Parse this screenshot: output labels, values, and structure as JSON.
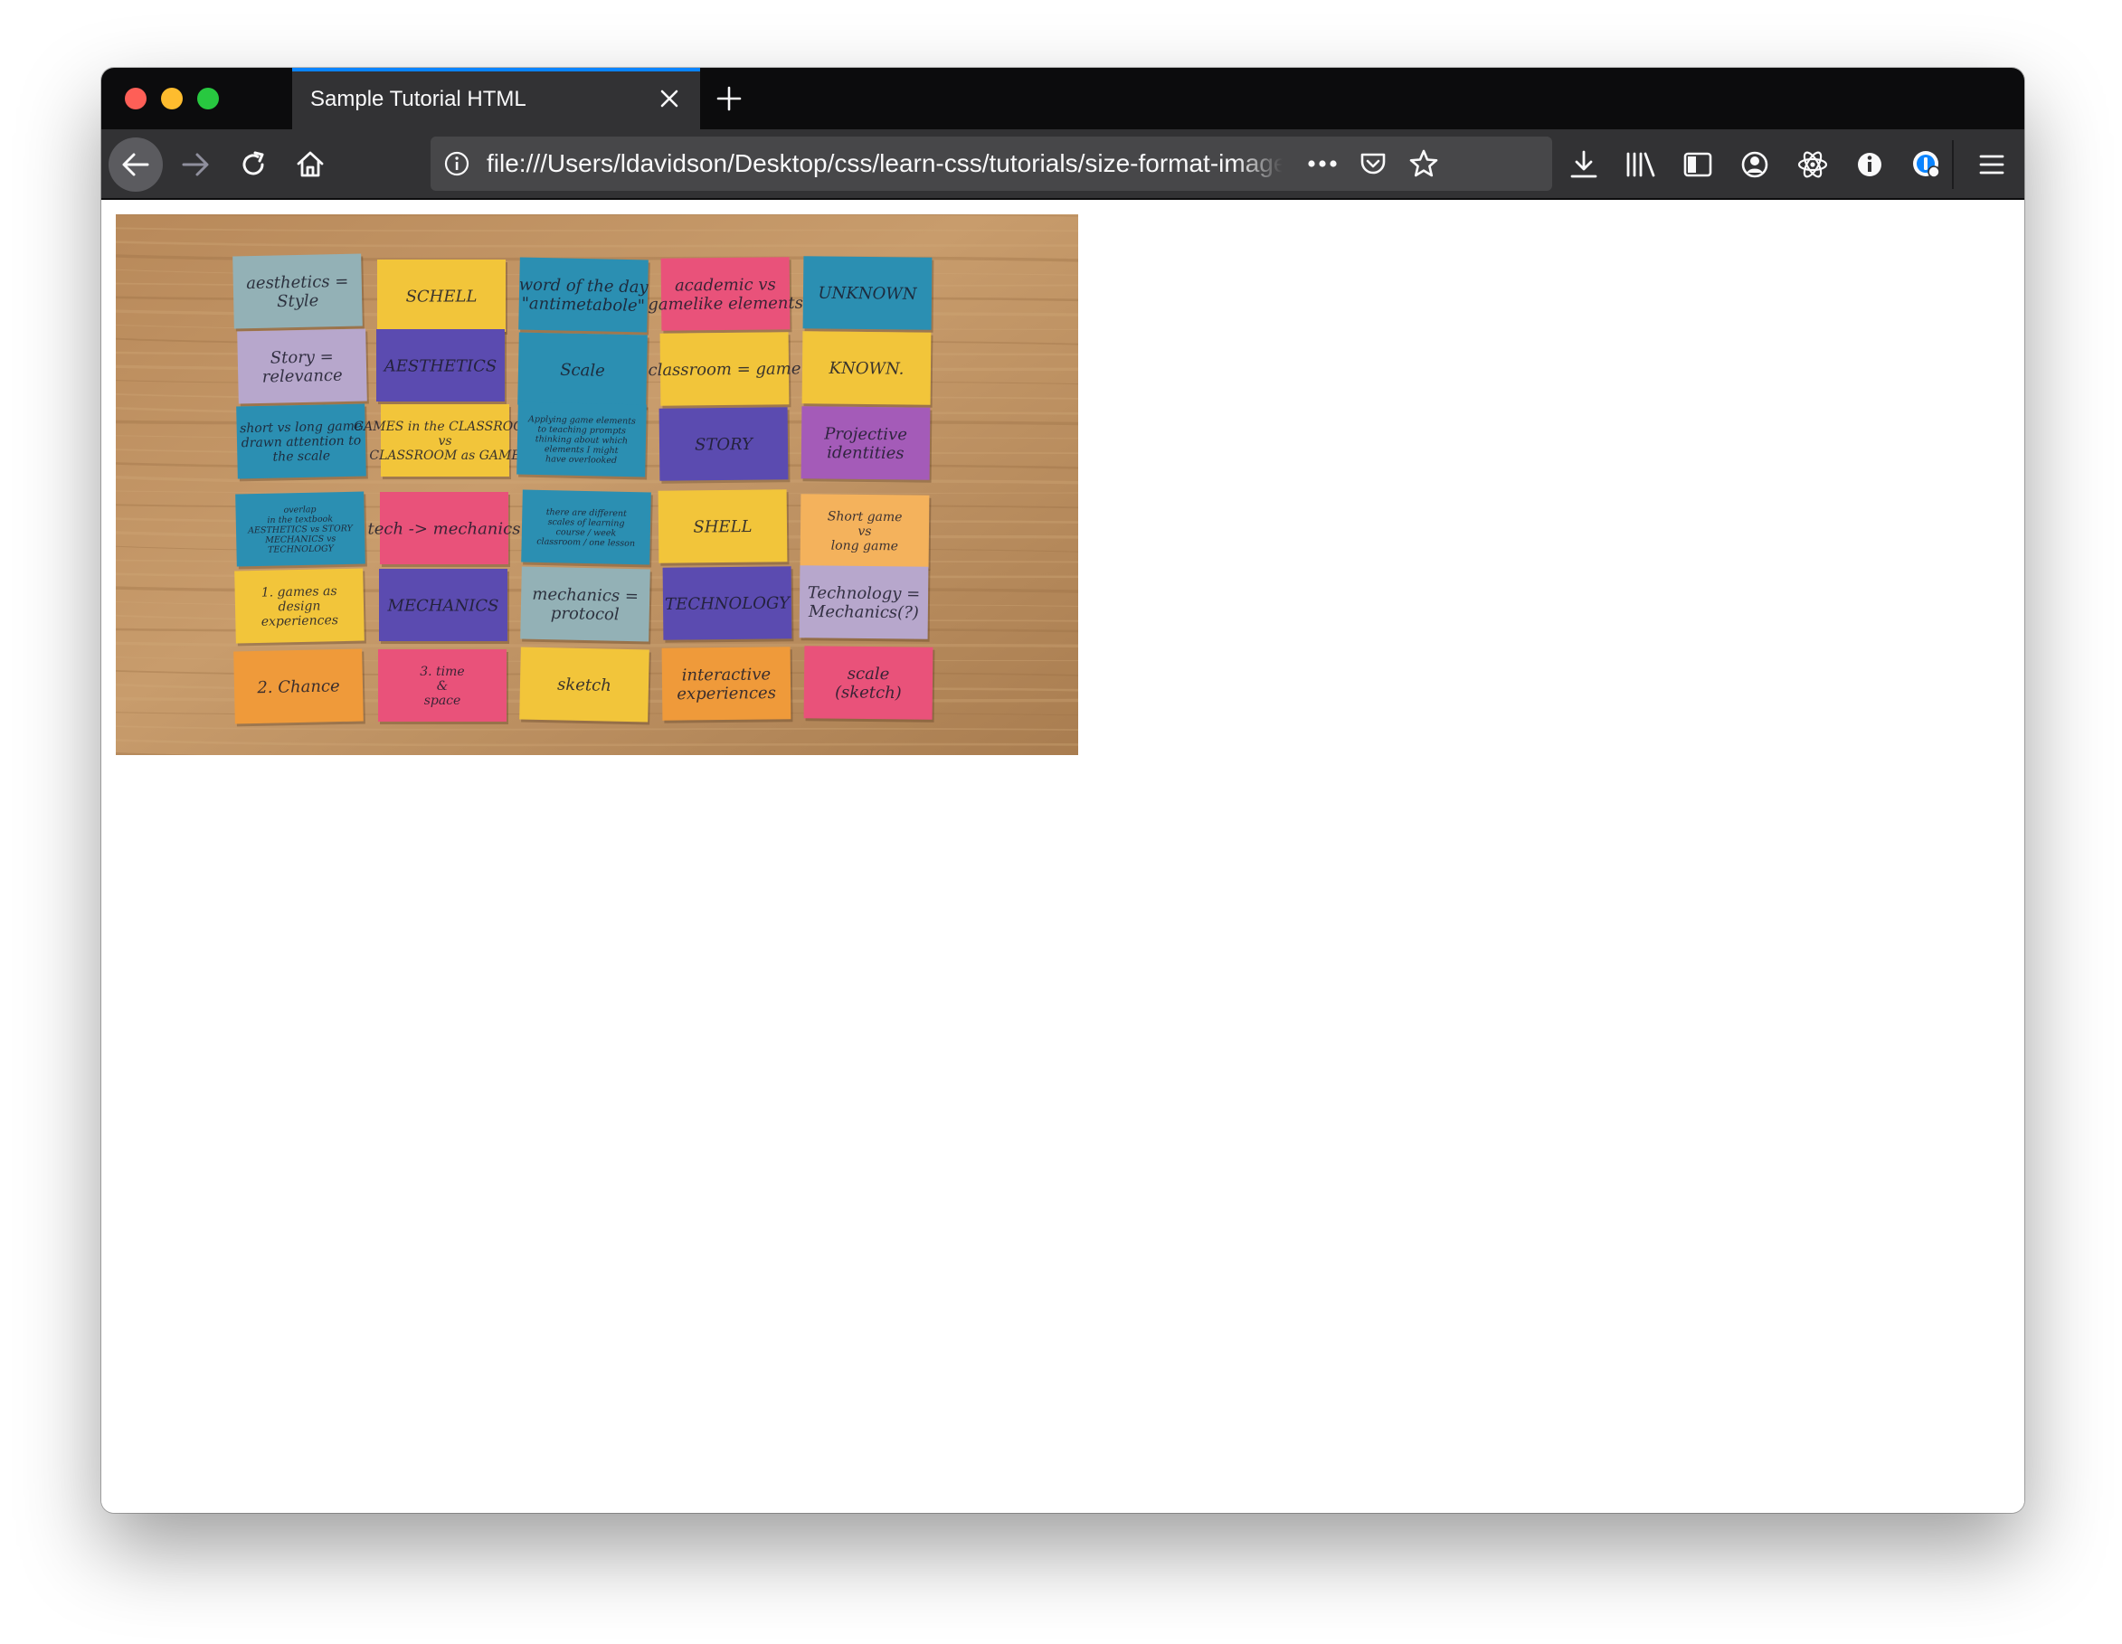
{
  "window": {
    "controls": [
      "close-button",
      "minimize-button",
      "maximize-button"
    ]
  },
  "tab": {
    "title": "Sample Tutorial HTML",
    "close_icon": "close-icon",
    "accent_color": "#0a84ff"
  },
  "new_tab": {
    "icon": "plus-icon"
  },
  "navigation": {
    "back_icon": "arrow-left-icon",
    "forward_icon": "arrow-right-icon",
    "reload_icon": "reload-icon",
    "home_icon": "home-icon"
  },
  "urlbar": {
    "url": "file:///Users/ldavidson/Desktop/css/learn-css/tutorials/size-format-images/",
    "info_icon": "info-icon",
    "page_actions_icon": "more-horizontal-icon",
    "pocket_icon": "pocket-icon",
    "bookmark_icon": "star-icon"
  },
  "toolbar": {
    "icons": [
      "download-icon",
      "library-icon",
      "sidebar-icon",
      "account-icon",
      "react-devtools-icon",
      "extension-info-icon",
      "password-manager-icon",
      "hamburger-menu-icon"
    ]
  },
  "content": {
    "image_subject": "photograph of colorful sticky notes with handwritten words on a wooden table",
    "sticky_notes": [
      {
        "color": "#93b1b6",
        "text": [
          "aesthetics =",
          "Style"
        ]
      },
      {
        "color": "#f2c53a",
        "text": [
          "SCHELL"
        ]
      },
      {
        "color": "#2b8fb2",
        "text": [
          "word of the day",
          "\"antimetabole\""
        ]
      },
      {
        "color": "#e9527a",
        "text": [
          "academic vs",
          "gamelike elements"
        ]
      },
      {
        "color": "#2b8fb2",
        "text": [
          "UNKNOWN"
        ]
      },
      {
        "color": "#b7a7cc",
        "text": [
          "Story =",
          "relevance"
        ]
      },
      {
        "color": "#5b4bb0",
        "text": [
          "AESTHETICS"
        ]
      },
      {
        "color": "#2b8fb2",
        "text": [
          "Scale"
        ]
      },
      {
        "color": "#f2c53a",
        "text": [
          "classroom = game"
        ]
      },
      {
        "color": "#f2c53a",
        "text": [
          "KNOWN."
        ]
      },
      {
        "color": "#2b8fb2",
        "text": [
          "short vs long game",
          "drawn attention to",
          "the scale"
        ]
      },
      {
        "color": "#f2c53a",
        "text": [
          "GAMES in the CLASSROOM",
          "vs",
          "CLASSROOM as GAME"
        ]
      },
      {
        "color": "#2b8fb2",
        "text": [
          "Applying game elements",
          "to teaching prompts",
          "thinking about which",
          "elements I might",
          "have overlooked"
        ]
      },
      {
        "color": "#5b4bb0",
        "text": [
          "STORY"
        ]
      },
      {
        "color": "#a45bb8",
        "text": [
          "Projective",
          "identities"
        ]
      },
      {
        "color": "#2b8fb2",
        "text": [
          "overlap",
          "in the textbook",
          "AESTHETICS vs STORY",
          "MECHANICS vs",
          "TECHNOLOGY"
        ]
      },
      {
        "color": "#e9527a",
        "text": [
          "tech -> mechanics"
        ]
      },
      {
        "color": "#2b8fb2",
        "text": [
          "there are different",
          "scales of learning",
          "course / week",
          "classroom / one lesson"
        ]
      },
      {
        "color": "#f2c53a",
        "text": [
          "SHELL"
        ]
      },
      {
        "color": "#f4b25c",
        "text": [
          "Short game",
          "vs",
          "long game"
        ]
      },
      {
        "color": "#f2c53a",
        "text": [
          "1. games as",
          "design",
          "experiences"
        ]
      },
      {
        "color": "#5b4bb0",
        "text": [
          "MECHANICS"
        ]
      },
      {
        "color": "#93b1b6",
        "text": [
          "mechanics =",
          "protocol"
        ]
      },
      {
        "color": "#5b4bb0",
        "text": [
          "TECHNOLOGY"
        ]
      },
      {
        "color": "#b7a7cc",
        "text": [
          "Technology =",
          "Mechanics(?)"
        ]
      },
      {
        "color": "#ef9a3a",
        "text": [
          "2. Chance"
        ]
      },
      {
        "color": "#e9527a",
        "text": [
          "3. time",
          "&",
          "space"
        ]
      },
      {
        "color": "#f2c53a",
        "text": [
          "sketch"
        ]
      },
      {
        "color": "#ef9a3a",
        "text": [
          "interactive",
          "experiences"
        ]
      },
      {
        "color": "#e9527a",
        "text": [
          "scale",
          "(sketch)"
        ]
      }
    ]
  }
}
